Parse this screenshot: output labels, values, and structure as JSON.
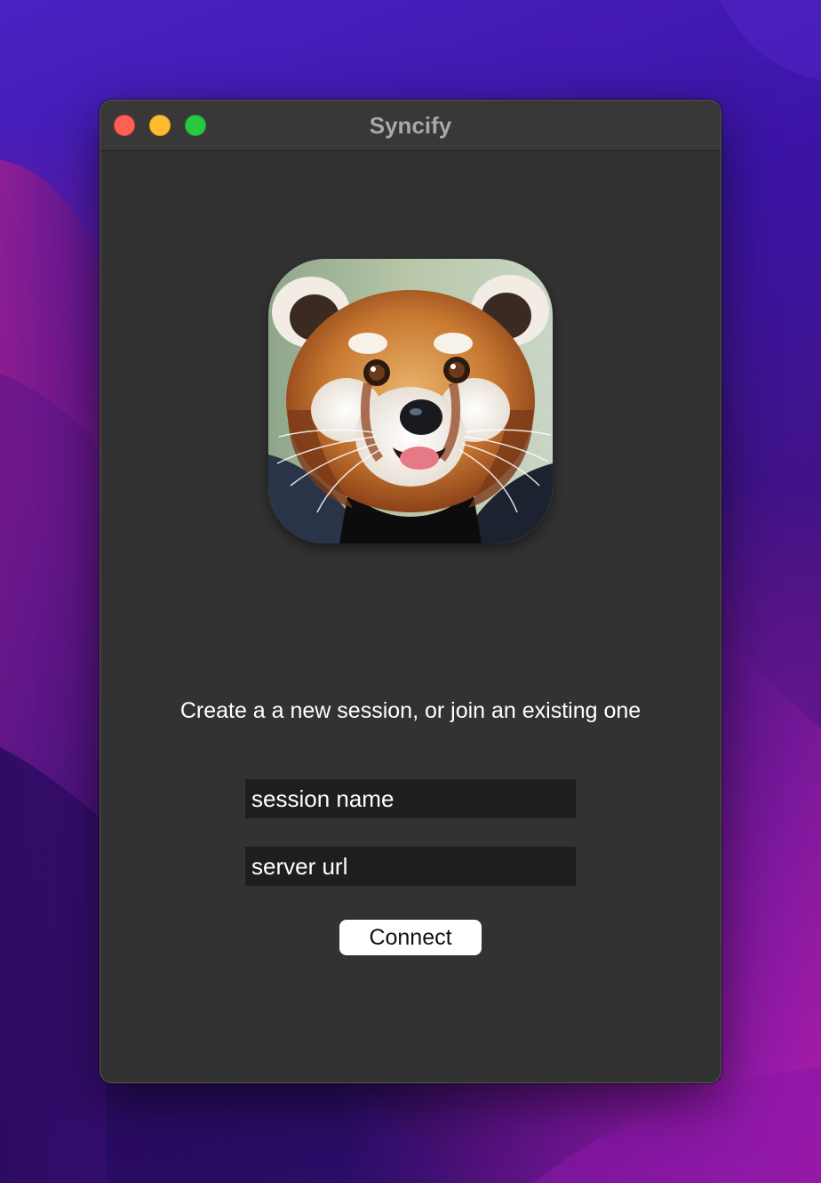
{
  "window": {
    "title": "Syncify"
  },
  "app_icon": {
    "name": "red-panda-icon"
  },
  "main": {
    "prompt": "Create a a new session, or join an existing one",
    "session_field": {
      "placeholder": "session name",
      "value": ""
    },
    "server_field": {
      "placeholder": "server url",
      "value": ""
    },
    "connect_label": "Connect"
  },
  "colors": {
    "window_bg": "#323232",
    "titlebar_bg": "#383838",
    "field_bg": "#1e1e1e",
    "button_bg": "#ffffff",
    "close": "#fe5f57",
    "minimize": "#febc2e",
    "zoom": "#28c840"
  }
}
